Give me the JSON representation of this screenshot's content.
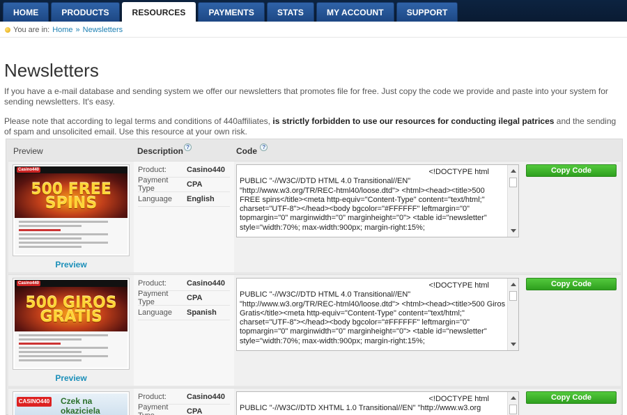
{
  "nav": {
    "tabs": [
      {
        "label": "HOME",
        "active": false
      },
      {
        "label": "PRODUCTS",
        "active": false
      },
      {
        "label": "RESOURCES",
        "active": true
      },
      {
        "label": "PAYMENTS",
        "active": false
      },
      {
        "label": "STATS",
        "active": false
      },
      {
        "label": "MY ACCOUNT",
        "active": false
      },
      {
        "label": "SUPPORT",
        "active": false
      }
    ]
  },
  "breadcrumb": {
    "prefix": "You are in:",
    "home": "Home",
    "separator": "»",
    "current": "Newsletters"
  },
  "page": {
    "title": "Newsletters",
    "intro": "If you have a e-mail database and sending system we offer our newsletters that promotes file for free. Just copy the code we provide and paste into your system for sending newsletters. It's easy.",
    "legal_pre": "Please note that according to legal terms and conditions of 440affiliates, ",
    "legal_bold": "is strictly forbidden to use our resources for conducting ilegal patrices",
    "legal_post": " and the sending of spam and unsolicited email. Use this resource at your own risk."
  },
  "table": {
    "headers": {
      "preview": "Preview",
      "description": "Description",
      "code": "Code"
    },
    "help_glyph": "?",
    "rows": [
      {
        "thumb_logo": "Casino440",
        "thumb_headline": "500 FREE SPINS",
        "preview_link": "Preview",
        "fields": [
          {
            "key": "Product:",
            "value": "Casino440"
          },
          {
            "key": "Payment Type",
            "value": "CPA"
          },
          {
            "key": "Language",
            "value": "English"
          }
        ],
        "code_first": "<!DOCTYPE html",
        "code_rest": "PUBLIC \"-//W3C//DTD HTML 4.0 Transitional//EN\" \"http://www.w3.org/TR/REC-html40/loose.dtd\"> <html><head><title>500 FREE spins</title><meta http-equiv=\"Content-Type\" content=\"text/html;\" charset=\"UTF-8\"></head><body bgcolor=\"#FFFFFF\" leftmargin=\"0\" topmargin=\"0\" marginwidth=\"0\" marginheight=\"0\"> <table id=\"newsletter\" style=\"width:70%; max-width:900px; margin-right:15%;",
        "copy_label": "Copy Code"
      },
      {
        "thumb_logo": "Casino440",
        "thumb_headline": "500 GIROS GRATIS",
        "preview_link": "Preview",
        "fields": [
          {
            "key": "Product:",
            "value": "Casino440"
          },
          {
            "key": "Payment Type",
            "value": "CPA"
          },
          {
            "key": "Language",
            "value": "Spanish"
          }
        ],
        "code_first": "<!DOCTYPE html",
        "code_rest": "PUBLIC \"-//W3C//DTD HTML 4.0 Transitional//EN\" \"http://www.w3.org/TR/REC-html40/loose.dtd\"> <html><head><title>500 Giros Gratis</title><meta http-equiv=\"Content-Type\" content=\"text/html;\" charset=\"UTF-8\"></head><body bgcolor=\"#FFFFFF\" leftmargin=\"0\" topmargin=\"0\" marginwidth=\"0\" marginheight=\"0\"> <table id=\"newsletter\" style=\"width:70%; max-width:900px; margin-right:15%;",
        "copy_label": "Copy Code"
      },
      {
        "thumb_logo": "CASINO440",
        "thumb_headline": "Czek na okaziciela",
        "preview_link": "",
        "fields": [
          {
            "key": "Product:",
            "value": "Casino440"
          },
          {
            "key": "Payment Type",
            "value": "CPA"
          }
        ],
        "code_first": "<!DOCTYPE html",
        "code_rest": "PUBLIC \"-//W3C//DTD XHTML 1.0 Transitional//EN\" \"http://www.w3.org",
        "copy_label": "Copy Code"
      }
    ]
  },
  "colors": {
    "nav_bg": "#0c2340",
    "tab_bg": "#2f63a8",
    "link": "#1b8fb9",
    "copy_button": "#3db52a"
  },
  "icons": {
    "breadcrumb": "bullet-icon",
    "help": "help-icon",
    "scroll_up": "arrow-up-icon",
    "scroll_down": "arrow-down-icon"
  }
}
